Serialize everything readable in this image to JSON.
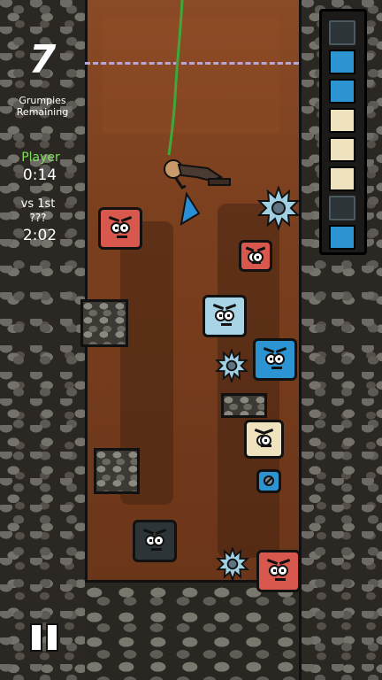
{
  "hud": {
    "grumpies_count": "7",
    "grumpies_label_1": "Grumpies",
    "grumpies_label_2": "Remaining",
    "player_label": "Player",
    "player_time": "0:14",
    "vs_label": "vs 1st",
    "rival_name": "???",
    "rival_time": "2:02"
  },
  "progress_slots": [
    "dark",
    "blue",
    "blue",
    "cream",
    "cream",
    "cream",
    "dark",
    "blue"
  ],
  "colors": {
    "red": "#d9584d",
    "light_blue": "#a8d4e6",
    "blue": "#2b94d1",
    "cream": "#efe2bf",
    "dark": "#2d3438",
    "rope": "#3ea83a",
    "flag": "#2a8fd6"
  },
  "icons": {
    "pause": "pause-icon",
    "gear": "spiked-gear-icon"
  }
}
